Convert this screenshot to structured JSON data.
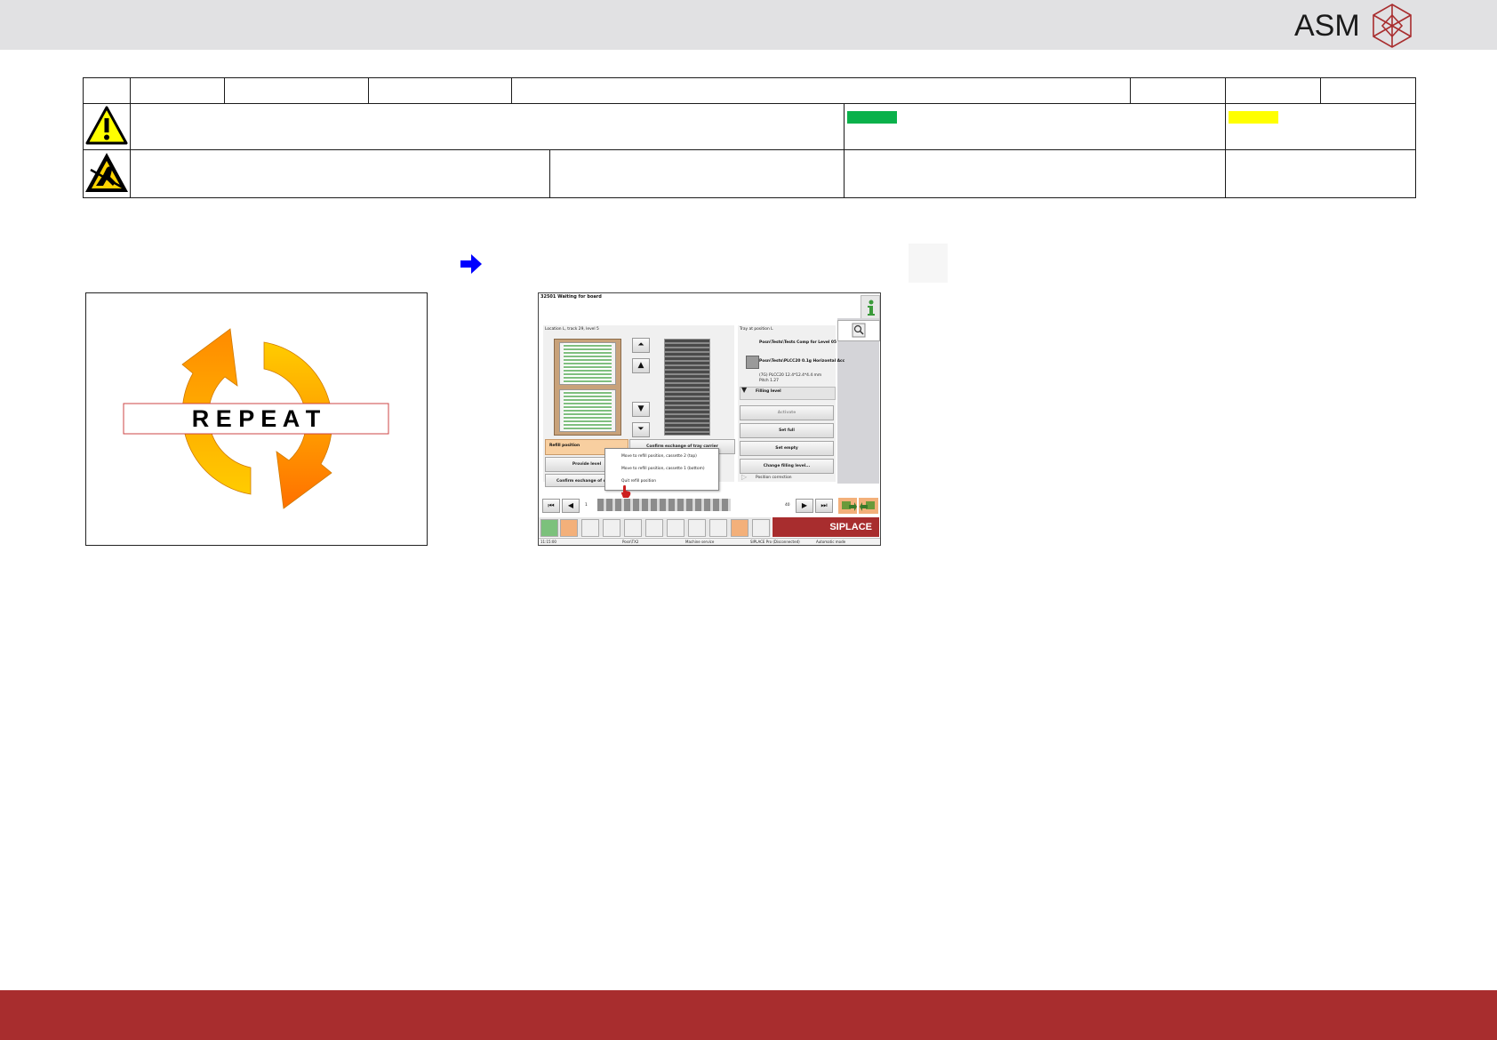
{
  "brand": {
    "logo_text": "ASM",
    "accent": "#a82d2e"
  },
  "colors": {
    "warning_green": "#0ab14b",
    "warning_yellow": "#ffff00",
    "arrow_blue": "#0000ff"
  },
  "figure_left": {
    "word": "R E P E A T"
  },
  "screen": {
    "title": "32501 Waiting for board",
    "left_pane_label": "Location L, track 29, level 5",
    "right_pane_label": "Tray at position L",
    "component_1": "Posn\\Tests\\Tests Comp for Level 05",
    "component_2": "Posn\\Tests\\PLCC20 0.1g Horizontal Acc",
    "component_3": "(7G) PLCC20 12.4*12.4*4.4 mm",
    "component_4": "Pitch 1.27",
    "filling_level": "Filling level",
    "btn_activate": "Activate",
    "btn_set_full": "Set full",
    "btn_set_empty": "Set empty",
    "btn_change_level": "Change filling level...",
    "position_correction": "Position correction",
    "refill_position": "Refill position",
    "btn_confirm_exchange": "Confirm exchange of tray carrier",
    "btn_provide_level": "Provide level",
    "btn_confirm_exchange_short": "Confirm exchange of ca",
    "menu_items": [
      "Move to refill position, cassette 2 (top)",
      "Move to refill position, cassette 1 (bottom)",
      "Quit refill position"
    ],
    "page_start": "1",
    "page_end": "40",
    "brand_label": "SIPLACE",
    "status": {
      "time": "11:15:00",
      "station": "Posn\\TX2",
      "mode_service": "Machine service",
      "connection": "SIPLACE Pro (Disconnected)",
      "mode": "Automatic mode"
    }
  }
}
